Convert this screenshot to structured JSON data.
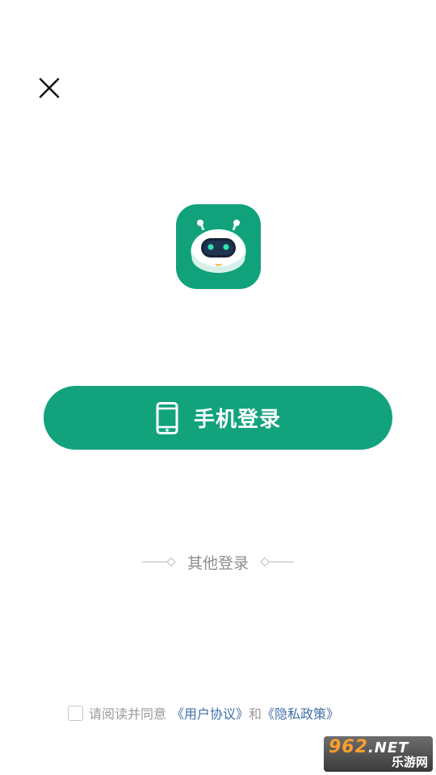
{
  "header": {
    "close_icon": "close-icon"
  },
  "logo": {
    "icon": "robot-app-icon",
    "color": "#11a27b"
  },
  "login": {
    "phone_login_label": "手机登录",
    "icon": "phone-icon",
    "color": "#12a37d"
  },
  "other_login": {
    "label": "其他登录"
  },
  "agreement": {
    "prefix": "请阅读并同意",
    "user_agreement": "《用户协议》",
    "conjunction": "和",
    "privacy_policy": "《隐私政策》",
    "checked": false
  },
  "watermark": {
    "brand_number": "962",
    "brand_domain": ".NET",
    "brand_name": "乐游网"
  }
}
